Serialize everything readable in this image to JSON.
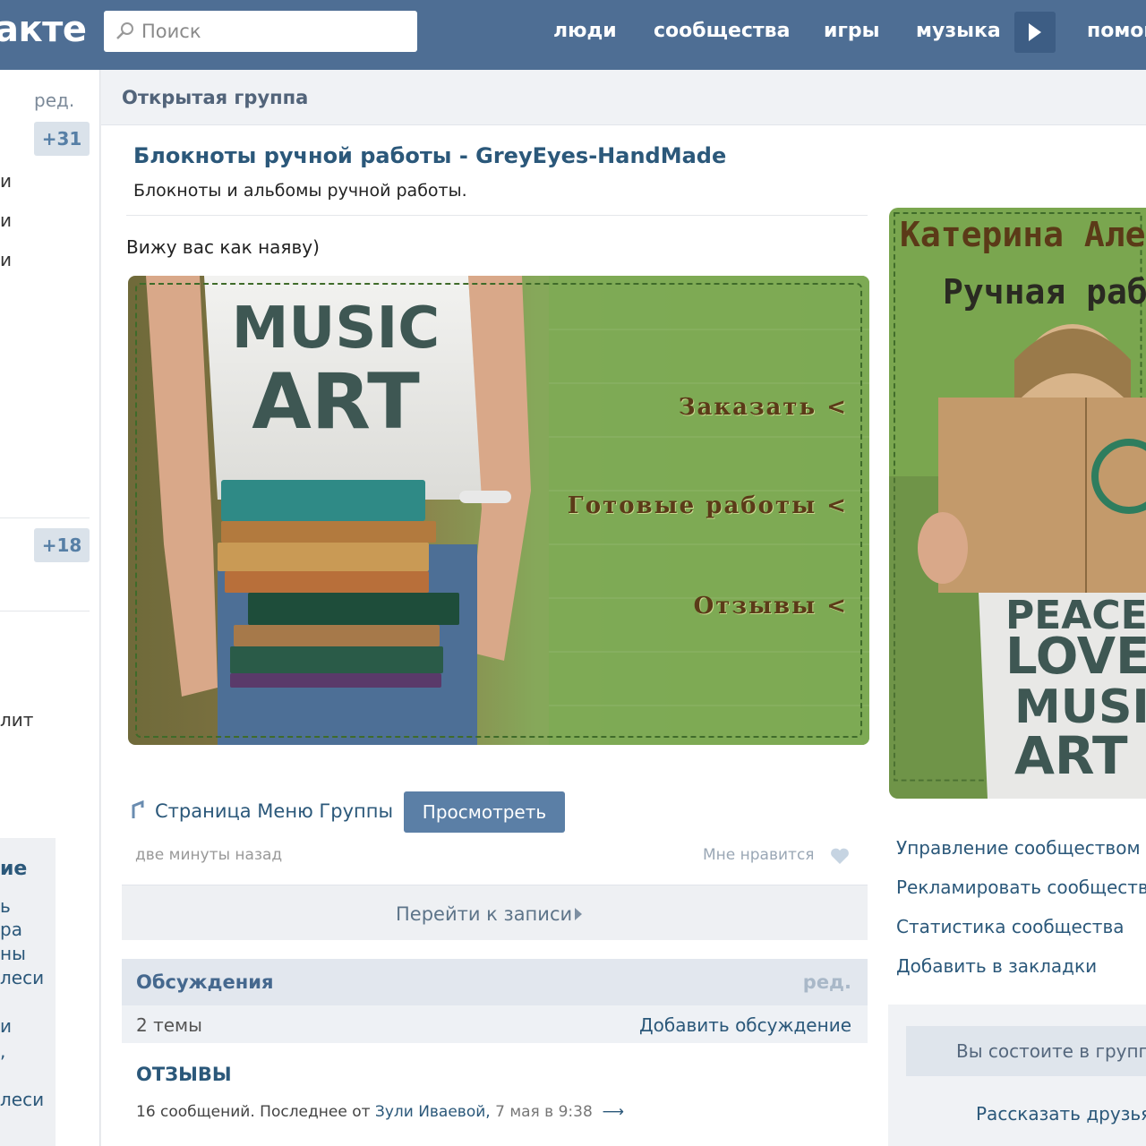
{
  "header": {
    "logo": "акте",
    "search_placeholder": "Поиск",
    "nav": [
      "люди",
      "сообщества",
      "игры",
      "музыка",
      "помощь"
    ]
  },
  "left": {
    "edit": "ред.",
    "badge1": "+31",
    "badge2": "+18",
    "fragments": [
      "и",
      "и",
      "и",
      "лит",
      "ие",
      "ь",
      "ра",
      "ны",
      "леси",
      "и",
      ",",
      "леси"
    ]
  },
  "group": {
    "type": "Открытая группа",
    "title": "Блокноты ручной работы - GreyEyes-HandMade",
    "description": "Блокноты и альбомы ручной работы."
  },
  "post": {
    "text": "Вижу вас как наяву)",
    "banner_links": [
      "Заказать <",
      "Готовые работы <",
      "Отзывы <"
    ],
    "banner_shirt": [
      "MUSIC",
      "ART"
    ],
    "attachment_label": "Страница Меню Группы",
    "view_button": "Просмотреть",
    "time": "две минуты назад",
    "like": "Мне нравится",
    "goto": "Перейти к записи"
  },
  "discussions": {
    "title": "Обсуждения",
    "edit": "ред.",
    "count": "2 темы",
    "add": "Добавить обсуждение",
    "topic": {
      "title": "ОТЗЫВЫ",
      "meta_prefix": "16 сообщений. Последнее от",
      "author": "Зули Иваевой,",
      "when": "7 мая в 9:38"
    }
  },
  "right": {
    "photo_text_1": "Катерина Але",
    "photo_text_2": "Ручная рабо",
    "photo_shirt": [
      "PEACE",
      "LOVE",
      "MUSIC",
      "ART"
    ],
    "actions": [
      "Управление сообществом",
      "Рекламировать сообщество",
      "Статистика сообщества",
      "Добавить в закладки"
    ],
    "member_button": "Вы состоите в группе",
    "tell_friends": "Рассказать друзьям"
  },
  "colors": {
    "header": "#4e6e94",
    "link": "#2b587a",
    "button": "#5b7fa6",
    "banner_green": "#7aa64f"
  }
}
